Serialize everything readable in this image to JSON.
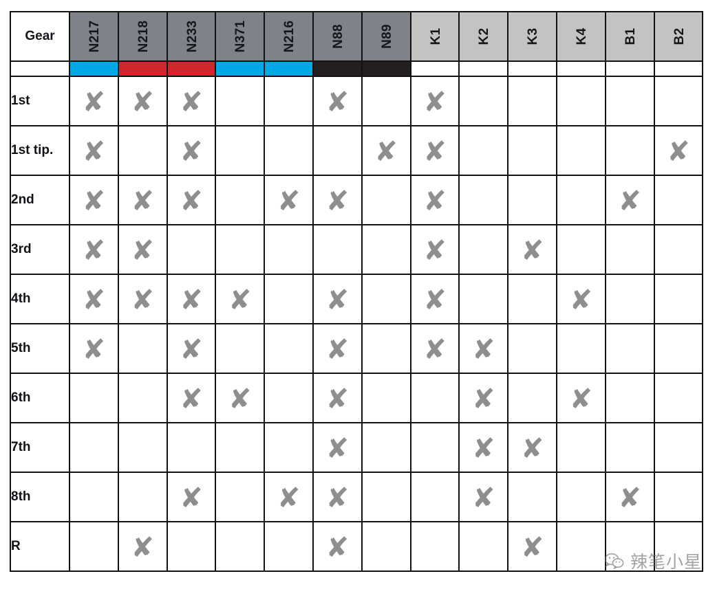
{
  "table": {
    "corner_label": "Gear",
    "columns": [
      {
        "label": "N217",
        "group": "n",
        "strip": "blue"
      },
      {
        "label": "N218",
        "group": "n",
        "strip": "red"
      },
      {
        "label": "N233",
        "group": "n",
        "strip": "red"
      },
      {
        "label": "N371",
        "group": "n",
        "strip": "blue"
      },
      {
        "label": "N216",
        "group": "n",
        "strip": "blue"
      },
      {
        "label": "N88",
        "group": "n",
        "strip": "dark"
      },
      {
        "label": "N89",
        "group": "n",
        "strip": "dark"
      },
      {
        "label": "K1",
        "group": "k",
        "strip": "none"
      },
      {
        "label": "K2",
        "group": "k",
        "strip": "none"
      },
      {
        "label": "K3",
        "group": "k",
        "strip": "none"
      },
      {
        "label": "K4",
        "group": "k",
        "strip": "none"
      },
      {
        "label": "B1",
        "group": "k",
        "strip": "none"
      },
      {
        "label": "B2",
        "group": "k",
        "strip": "none"
      }
    ],
    "mark_glyph": "✘",
    "rows": [
      {
        "label": "1st",
        "marks": [
          1,
          1,
          1,
          0,
          0,
          1,
          0,
          1,
          0,
          0,
          0,
          0,
          0
        ]
      },
      {
        "label": "1st tip.",
        "marks": [
          1,
          0,
          1,
          0,
          0,
          0,
          1,
          1,
          0,
          0,
          0,
          0,
          1
        ]
      },
      {
        "label": "2nd",
        "marks": [
          1,
          1,
          1,
          0,
          1,
          1,
          0,
          1,
          0,
          0,
          0,
          1,
          0
        ]
      },
      {
        "label": "3rd",
        "marks": [
          1,
          1,
          0,
          0,
          0,
          0,
          0,
          1,
          0,
          1,
          0,
          0,
          0
        ]
      },
      {
        "label": "4th",
        "marks": [
          1,
          1,
          1,
          1,
          0,
          1,
          0,
          1,
          0,
          0,
          1,
          0,
          0
        ]
      },
      {
        "label": "5th",
        "marks": [
          1,
          0,
          1,
          0,
          0,
          1,
          0,
          1,
          1,
          0,
          0,
          0,
          0
        ]
      },
      {
        "label": "6th",
        "marks": [
          0,
          0,
          1,
          1,
          0,
          1,
          0,
          0,
          1,
          0,
          1,
          0,
          0
        ]
      },
      {
        "label": "7th",
        "marks": [
          0,
          0,
          0,
          0,
          0,
          1,
          0,
          0,
          1,
          1,
          0,
          0,
          0
        ]
      },
      {
        "label": "8th",
        "marks": [
          0,
          0,
          1,
          0,
          1,
          1,
          0,
          0,
          1,
          0,
          0,
          1,
          0
        ]
      },
      {
        "label": "R",
        "marks": [
          0,
          1,
          0,
          0,
          0,
          1,
          0,
          0,
          0,
          1,
          0,
          0,
          0
        ]
      }
    ]
  },
  "watermark": {
    "text": "辣笔小星",
    "icon": "wechat-icon"
  },
  "colors": {
    "strip_blue": "#00A8E6",
    "strip_red": "#D1262C",
    "strip_dark": "#231F1E",
    "header_n_gray": "#7F8288",
    "header_k_gray": "#C3C3C4",
    "mark_gray": "#8E8E8E",
    "grid_line": "#111111"
  }
}
